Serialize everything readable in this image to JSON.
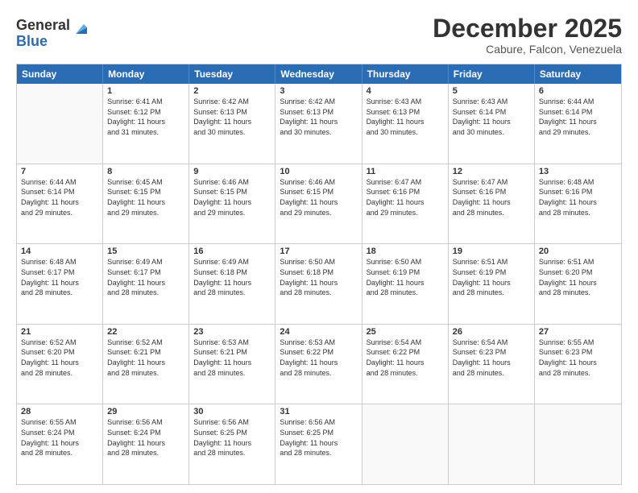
{
  "logo": {
    "general": "General",
    "blue": "Blue"
  },
  "header": {
    "month": "December 2025",
    "location": "Cabure, Falcon, Venezuela"
  },
  "days": [
    "Sunday",
    "Monday",
    "Tuesday",
    "Wednesday",
    "Thursday",
    "Friday",
    "Saturday"
  ],
  "weeks": [
    [
      {
        "num": "",
        "lines": [],
        "empty": true
      },
      {
        "num": "1",
        "lines": [
          "Sunrise: 6:41 AM",
          "Sunset: 6:12 PM",
          "Daylight: 11 hours",
          "and 31 minutes."
        ]
      },
      {
        "num": "2",
        "lines": [
          "Sunrise: 6:42 AM",
          "Sunset: 6:13 PM",
          "Daylight: 11 hours",
          "and 30 minutes."
        ]
      },
      {
        "num": "3",
        "lines": [
          "Sunrise: 6:42 AM",
          "Sunset: 6:13 PM",
          "Daylight: 11 hours",
          "and 30 minutes."
        ]
      },
      {
        "num": "4",
        "lines": [
          "Sunrise: 6:43 AM",
          "Sunset: 6:13 PM",
          "Daylight: 11 hours",
          "and 30 minutes."
        ]
      },
      {
        "num": "5",
        "lines": [
          "Sunrise: 6:43 AM",
          "Sunset: 6:14 PM",
          "Daylight: 11 hours",
          "and 30 minutes."
        ]
      },
      {
        "num": "6",
        "lines": [
          "Sunrise: 6:44 AM",
          "Sunset: 6:14 PM",
          "Daylight: 11 hours",
          "and 29 minutes."
        ]
      }
    ],
    [
      {
        "num": "7",
        "lines": [
          "Sunrise: 6:44 AM",
          "Sunset: 6:14 PM",
          "Daylight: 11 hours",
          "and 29 minutes."
        ]
      },
      {
        "num": "8",
        "lines": [
          "Sunrise: 6:45 AM",
          "Sunset: 6:15 PM",
          "Daylight: 11 hours",
          "and 29 minutes."
        ]
      },
      {
        "num": "9",
        "lines": [
          "Sunrise: 6:46 AM",
          "Sunset: 6:15 PM",
          "Daylight: 11 hours",
          "and 29 minutes."
        ]
      },
      {
        "num": "10",
        "lines": [
          "Sunrise: 6:46 AM",
          "Sunset: 6:15 PM",
          "Daylight: 11 hours",
          "and 29 minutes."
        ]
      },
      {
        "num": "11",
        "lines": [
          "Sunrise: 6:47 AM",
          "Sunset: 6:16 PM",
          "Daylight: 11 hours",
          "and 29 minutes."
        ]
      },
      {
        "num": "12",
        "lines": [
          "Sunrise: 6:47 AM",
          "Sunset: 6:16 PM",
          "Daylight: 11 hours",
          "and 28 minutes."
        ]
      },
      {
        "num": "13",
        "lines": [
          "Sunrise: 6:48 AM",
          "Sunset: 6:16 PM",
          "Daylight: 11 hours",
          "and 28 minutes."
        ]
      }
    ],
    [
      {
        "num": "14",
        "lines": [
          "Sunrise: 6:48 AM",
          "Sunset: 6:17 PM",
          "Daylight: 11 hours",
          "and 28 minutes."
        ]
      },
      {
        "num": "15",
        "lines": [
          "Sunrise: 6:49 AM",
          "Sunset: 6:17 PM",
          "Daylight: 11 hours",
          "and 28 minutes."
        ]
      },
      {
        "num": "16",
        "lines": [
          "Sunrise: 6:49 AM",
          "Sunset: 6:18 PM",
          "Daylight: 11 hours",
          "and 28 minutes."
        ]
      },
      {
        "num": "17",
        "lines": [
          "Sunrise: 6:50 AM",
          "Sunset: 6:18 PM",
          "Daylight: 11 hours",
          "and 28 minutes."
        ]
      },
      {
        "num": "18",
        "lines": [
          "Sunrise: 6:50 AM",
          "Sunset: 6:19 PM",
          "Daylight: 11 hours",
          "and 28 minutes."
        ]
      },
      {
        "num": "19",
        "lines": [
          "Sunrise: 6:51 AM",
          "Sunset: 6:19 PM",
          "Daylight: 11 hours",
          "and 28 minutes."
        ]
      },
      {
        "num": "20",
        "lines": [
          "Sunrise: 6:51 AM",
          "Sunset: 6:20 PM",
          "Daylight: 11 hours",
          "and 28 minutes."
        ]
      }
    ],
    [
      {
        "num": "21",
        "lines": [
          "Sunrise: 6:52 AM",
          "Sunset: 6:20 PM",
          "Daylight: 11 hours",
          "and 28 minutes."
        ]
      },
      {
        "num": "22",
        "lines": [
          "Sunrise: 6:52 AM",
          "Sunset: 6:21 PM",
          "Daylight: 11 hours",
          "and 28 minutes."
        ]
      },
      {
        "num": "23",
        "lines": [
          "Sunrise: 6:53 AM",
          "Sunset: 6:21 PM",
          "Daylight: 11 hours",
          "and 28 minutes."
        ]
      },
      {
        "num": "24",
        "lines": [
          "Sunrise: 6:53 AM",
          "Sunset: 6:22 PM",
          "Daylight: 11 hours",
          "and 28 minutes."
        ]
      },
      {
        "num": "25",
        "lines": [
          "Sunrise: 6:54 AM",
          "Sunset: 6:22 PM",
          "Daylight: 11 hours",
          "and 28 minutes."
        ]
      },
      {
        "num": "26",
        "lines": [
          "Sunrise: 6:54 AM",
          "Sunset: 6:23 PM",
          "Daylight: 11 hours",
          "and 28 minutes."
        ]
      },
      {
        "num": "27",
        "lines": [
          "Sunrise: 6:55 AM",
          "Sunset: 6:23 PM",
          "Daylight: 11 hours",
          "and 28 minutes."
        ]
      }
    ],
    [
      {
        "num": "28",
        "lines": [
          "Sunrise: 6:55 AM",
          "Sunset: 6:24 PM",
          "Daylight: 11 hours",
          "and 28 minutes."
        ]
      },
      {
        "num": "29",
        "lines": [
          "Sunrise: 6:56 AM",
          "Sunset: 6:24 PM",
          "Daylight: 11 hours",
          "and 28 minutes."
        ]
      },
      {
        "num": "30",
        "lines": [
          "Sunrise: 6:56 AM",
          "Sunset: 6:25 PM",
          "Daylight: 11 hours",
          "and 28 minutes."
        ]
      },
      {
        "num": "31",
        "lines": [
          "Sunrise: 6:56 AM",
          "Sunset: 6:25 PM",
          "Daylight: 11 hours",
          "and 28 minutes."
        ]
      },
      {
        "num": "",
        "lines": [],
        "empty": true
      },
      {
        "num": "",
        "lines": [],
        "empty": true
      },
      {
        "num": "",
        "lines": [],
        "empty": true
      }
    ]
  ]
}
